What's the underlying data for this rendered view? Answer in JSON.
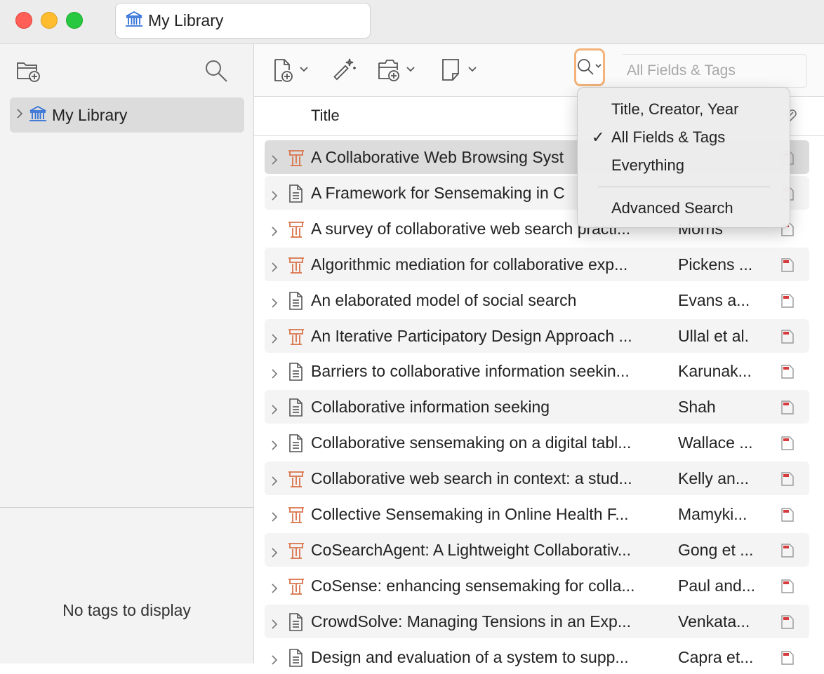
{
  "window": {
    "tab_title": "My Library"
  },
  "sidebar": {
    "collections": [
      {
        "label": "My Library"
      }
    ],
    "tag_pane_empty_text": "No tags to display"
  },
  "search": {
    "placeholder": "All Fields & Tags",
    "mode_menu": {
      "items": [
        {
          "label": "Title, Creator, Year",
          "checked": false
        },
        {
          "label": "All Fields & Tags",
          "checked": true
        },
        {
          "label": "Everything",
          "checked": false
        },
        {
          "label": "Advanced Search",
          "checked": false
        }
      ],
      "check_mark": "✓"
    }
  },
  "columns": {
    "title": "Title",
    "attachment_icon": "paperclip-icon"
  },
  "items": [
    {
      "title": "A Collaborative Web Browsing Syst",
      "creator": "",
      "type": "presentation",
      "attachment": "pdf"
    },
    {
      "title": "A Framework for Sensemaking in C",
      "creator": "",
      "type": "document",
      "attachment": "pdf"
    },
    {
      "title": "A survey of collaborative web search practi...",
      "creator": "Morris",
      "type": "presentation",
      "attachment": "pdf"
    },
    {
      "title": "Algorithmic mediation for collaborative exp...",
      "creator": "Pickens ...",
      "type": "presentation",
      "attachment": "pdf"
    },
    {
      "title": "An elaborated model of social search",
      "creator": "Evans a...",
      "type": "document",
      "attachment": "pdf"
    },
    {
      "title": "An Iterative Participatory Design Approach ...",
      "creator": "Ullal et al.",
      "type": "presentation",
      "attachment": "pdf"
    },
    {
      "title": "Barriers to collaborative information seekin...",
      "creator": "Karunak...",
      "type": "document",
      "attachment": "pdf"
    },
    {
      "title": "Collaborative information seeking",
      "creator": "Shah",
      "type": "document",
      "attachment": "pdf"
    },
    {
      "title": "Collaborative sensemaking on a digital tabl...",
      "creator": "Wallace ...",
      "type": "document",
      "attachment": "pdf"
    },
    {
      "title": "Collaborative web search in context: a stud...",
      "creator": "Kelly an...",
      "type": "presentation",
      "attachment": "pdf"
    },
    {
      "title": "Collective Sensemaking in Online Health F...",
      "creator": "Mamyki...",
      "type": "presentation",
      "attachment": "pdf"
    },
    {
      "title": "CoSearchAgent: A Lightweight Collaborativ...",
      "creator": "Gong et ...",
      "type": "presentation",
      "attachment": "pdf"
    },
    {
      "title": "CoSense: enhancing sensemaking for colla...",
      "creator": "Paul and...",
      "type": "presentation",
      "attachment": "pdf"
    },
    {
      "title": "CrowdSolve: Managing Tensions in an Exp...",
      "creator": "Venkata...",
      "type": "document",
      "attachment": "pdf"
    },
    {
      "title": "Design and evaluation of a system to supp...",
      "creator": "Capra et...",
      "type": "document",
      "attachment": "pdf"
    }
  ],
  "colors": {
    "accent_library": "#2f6fd6",
    "presentation_icon": "#d9734a",
    "search_focus_ring": "#f3b37a",
    "pdf_red": "#d83b3b"
  }
}
